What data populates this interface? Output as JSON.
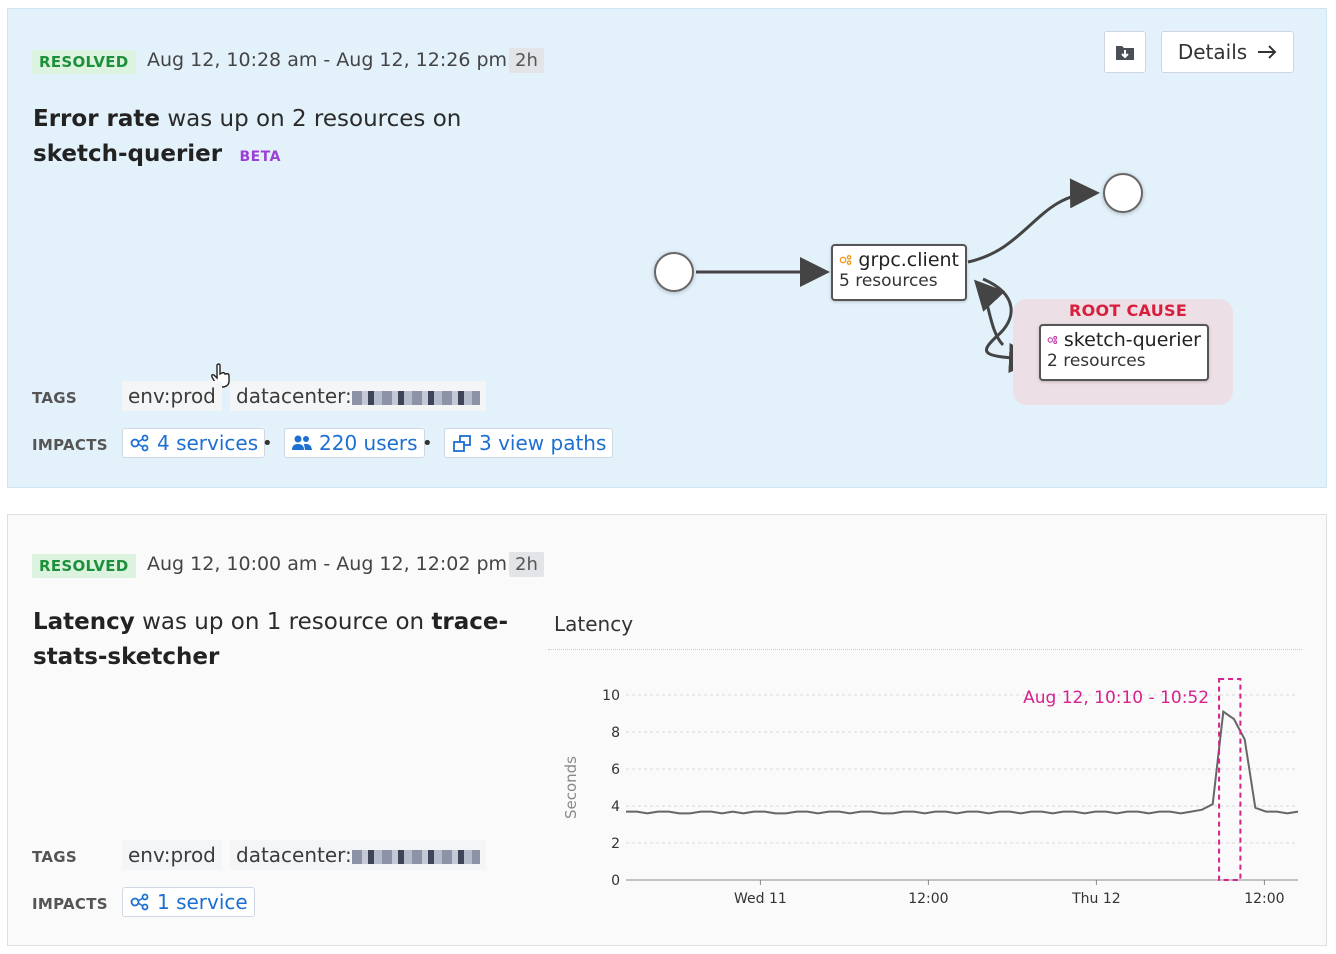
{
  "incident1": {
    "status": "RESOLVED",
    "time_range": "Aug 12, 10:28 am - Aug 12, 12:26 pm",
    "duration": "2h",
    "title_metric": "Error rate",
    "title_middle": " was up on 2 resources on",
    "title_service": "sketch-querier",
    "beta": "BETA",
    "details_label": "Details",
    "tags_label": "TAGS",
    "tags": [
      "env:prod",
      "datacenter:"
    ],
    "impacts_label": "IMPACTS",
    "impacts": [
      {
        "label": "4 services",
        "icon": "services-icon"
      },
      {
        "label": "220 users",
        "icon": "users-icon"
      },
      {
        "label": "3 view paths",
        "icon": "view-paths-icon"
      }
    ],
    "graph": {
      "node_a": {
        "title": "grpc.client",
        "sub": "5 resources",
        "icon_color": "#f29a1e"
      },
      "node_b": {
        "title": "sketch-querier",
        "sub": "2 resources",
        "icon_color": "#c03aa8"
      },
      "root_cause_label": "ROOT CAUSE"
    }
  },
  "incident2": {
    "status": "RESOLVED",
    "time_range": "Aug 12, 10:00 am - Aug 12, 12:02 pm",
    "duration": "2h",
    "title_metric": "Latency",
    "title_middle": " was up on 1 resource on ",
    "title_service_part1": "trace-",
    "title_service_part2": "stats-sketcher",
    "tags_label": "TAGS",
    "tags": [
      "env:prod",
      "datacenter:"
    ],
    "impacts_label": "IMPACTS",
    "impacts": [
      {
        "label": "1 service",
        "icon": "services-icon"
      }
    ]
  },
  "colors": {
    "accent_blue": "#1d6fd1",
    "resolved_green": "#1e8f3a",
    "highlight_magenta": "#d6218f",
    "root_cause_red": "#d81e3c"
  },
  "chart_data": {
    "type": "line",
    "title": "Latency",
    "ylabel": "Seconds",
    "ylim": [
      0,
      10
    ],
    "yticks": [
      0,
      2,
      4,
      6,
      8,
      10
    ],
    "xtick_labels": [
      "Wed 11",
      "12:00",
      "Thu 12",
      "12:00"
    ],
    "grid": true,
    "highlight_label": "Aug 12, 10:10 - 10:52",
    "series": [
      {
        "values": [
          3.7,
          3.7,
          3.6,
          3.7,
          3.7,
          3.6,
          3.6,
          3.7,
          3.7,
          3.6,
          3.7,
          3.6,
          3.7,
          3.7,
          3.6,
          3.6,
          3.7,
          3.7,
          3.6,
          3.7,
          3.7,
          3.6,
          3.7,
          3.7,
          3.6,
          3.6,
          3.7,
          3.7,
          3.6,
          3.7,
          3.7,
          3.6,
          3.7,
          3.7,
          3.6,
          3.7,
          3.7,
          3.6,
          3.7,
          3.7,
          3.6,
          3.7,
          3.7,
          3.6,
          3.7,
          3.7,
          3.6,
          3.7,
          3.7,
          3.6,
          3.7,
          3.7,
          3.6,
          3.7,
          3.8,
          4.1,
          9.1,
          8.7,
          7.6,
          3.9,
          3.7,
          3.7,
          3.6,
          3.7
        ]
      }
    ]
  }
}
